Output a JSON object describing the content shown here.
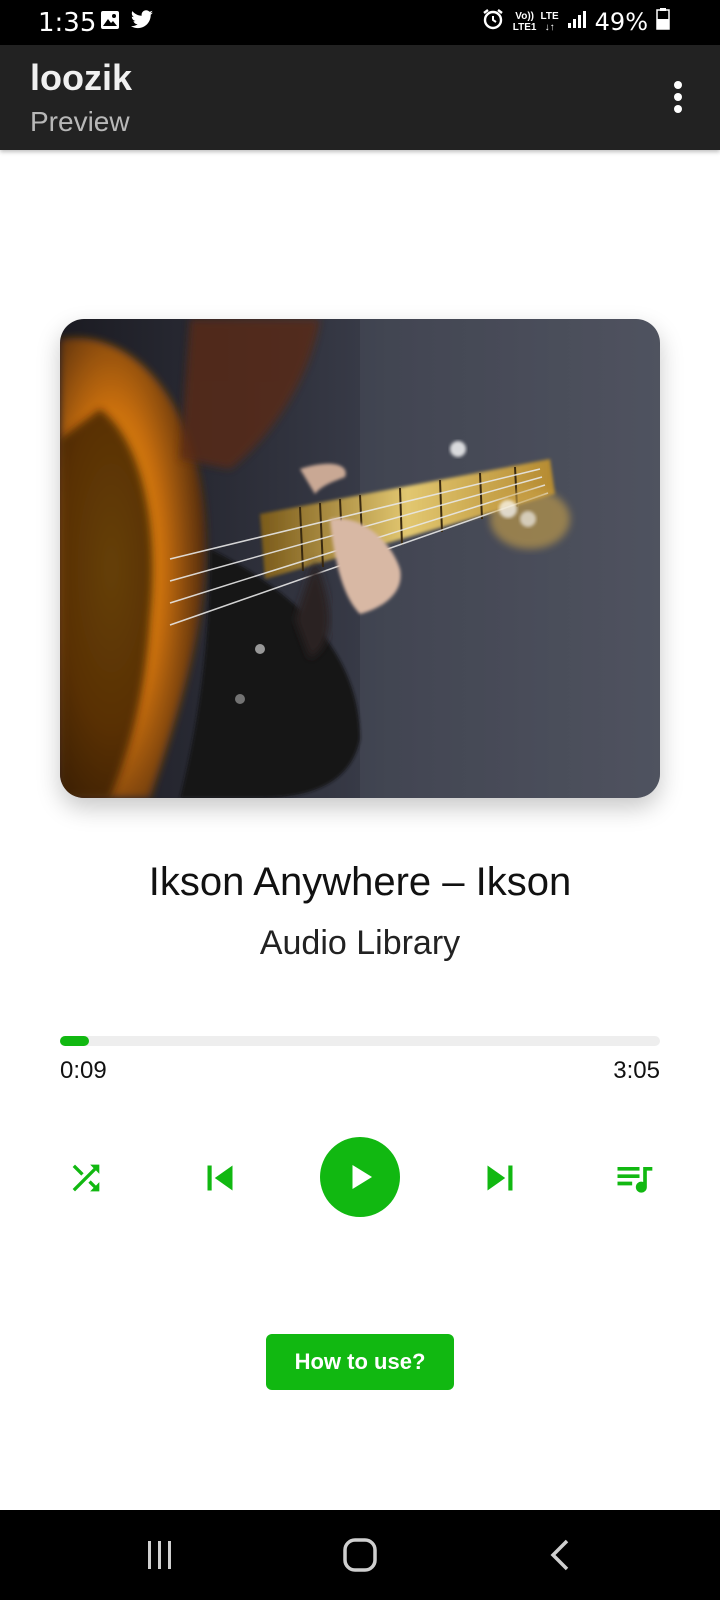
{
  "status_bar": {
    "time": "1:35",
    "battery": "49%",
    "network_top": "Vo))",
    "network_bottom": "LTE1",
    "lte_label": "LTE",
    "icons_left": [
      "image-icon",
      "twitter-icon"
    ],
    "icons_right": [
      "alarm-icon",
      "signal-icon",
      "battery-icon"
    ]
  },
  "app_bar": {
    "title": "loozik",
    "subtitle": "Preview",
    "menu_icon": "more-vert-icon"
  },
  "now_playing": {
    "title": "Ikson Anywhere – Ikson",
    "artist": "Audio Library",
    "elapsed": "0:09",
    "duration": "3:05",
    "progress_percent": 4.9,
    "album_art": "bass-guitar-photo"
  },
  "controls": {
    "icons": [
      "shuffle-icon",
      "skip-previous-icon",
      "play-icon",
      "skip-next-icon",
      "queue-music-icon"
    ]
  },
  "help_button": {
    "label": "How to use?"
  },
  "colors": {
    "accent": "#11b811",
    "app_bar": "#222222",
    "status_bar": "#000000",
    "progress_track": "#eeeeee"
  },
  "nav_bar": {
    "icons": [
      "recent-apps-icon",
      "home-icon",
      "back-icon"
    ]
  }
}
